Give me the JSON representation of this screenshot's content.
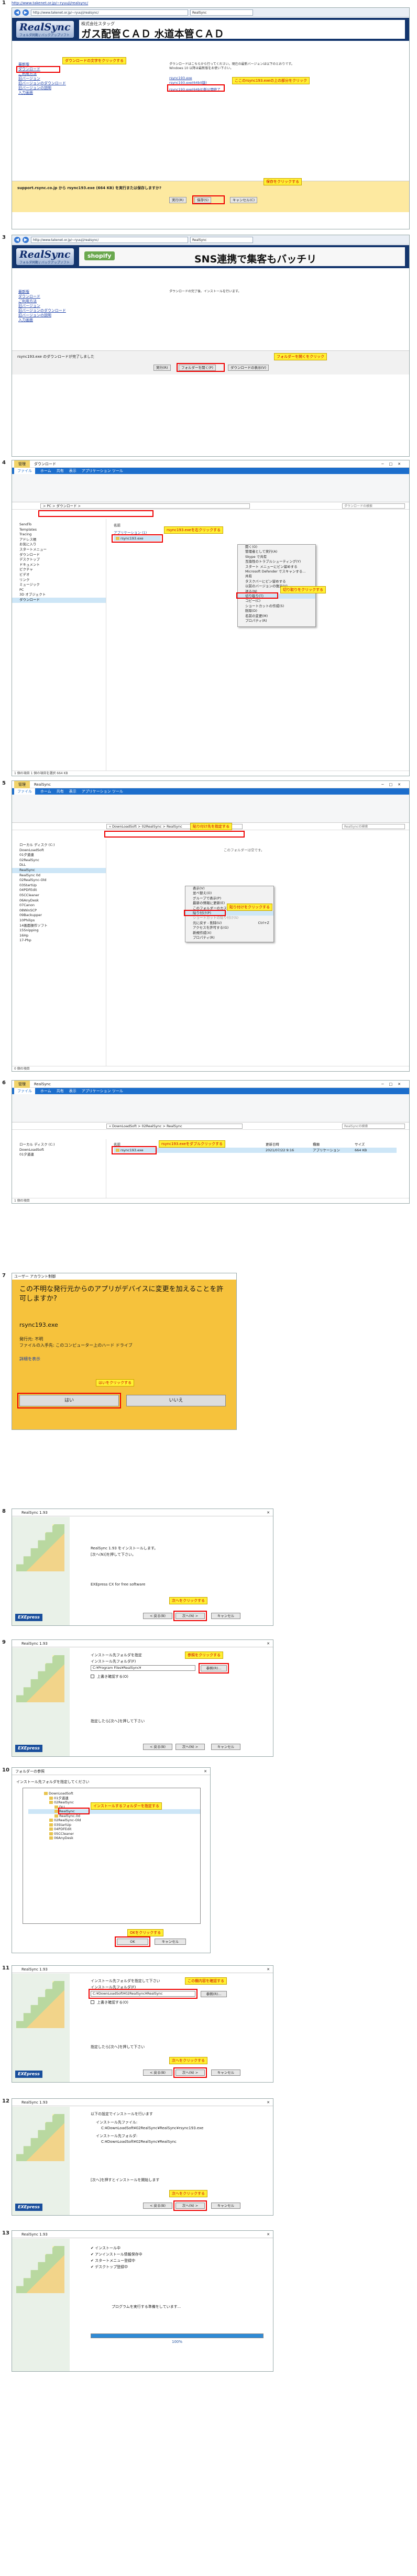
{
  "page_url": "http://www.takenet.or.jp/~ryuuji/realsync/",
  "steps": {
    "s1": {
      "num": "1",
      "ie_addr": "http://www.takenet.or.jp/~ryuuji/realsync/",
      "ie_tab": "RealSync",
      "logo": "RealSync",
      "logo_sub": "フォルダ同期 / バックアップソフト",
      "ad_small": "株式会社スタッグ",
      "ad_big": "ガス配管ＣＡＤ 水道本管ＣＡＤ",
      "nav": [
        "最新版",
        "ダウンロード",
        "ご利用方法",
        "旧バージョン",
        "旧バージョンのダウンロード",
        "旧バージョンの説明",
        "入力画面"
      ],
      "callout_dl": "ダウンロードの文字をクリックする",
      "body": "ダウンロードはこちらから行ってください。現在の最新バージョンは以下のとおりです。Windows 10 以降は最新版をお使い下さい。",
      "link1": "rsync193.exe",
      "link2": "rsync193.exe(64bit版)",
      "link3": "rsync193.exe(64bit)版公開終了",
      "callout_link": "ここのrsync193.exeの上の部分をクリック",
      "dl_text": "support.rsync.co.jp から rsync193.exe (664 KB) を実行または保存しますか?",
      "dl_run": "実行(R)",
      "dl_save": "保存(S)",
      "dl_cancel": "キャンセル(C)",
      "callout_save": "保存をクリックする"
    },
    "s3": {
      "num": "3",
      "ie_addr": "http://www.takenet.or.jp/~ryuuji/realsync/",
      "ie_tab": "RealSync",
      "logo": "RealSync",
      "logo_sub": "フォルダ同期 / バックアップソフト",
      "ad_small": "shopify",
      "ad_big": "SNS連携で集客もバッチリ",
      "nav": [
        "最新版",
        "ダウンロード",
        "ご利用方法",
        "旧バージョン",
        "旧バージョンのダウンロード",
        "旧バージョンの説明",
        "入力画面"
      ],
      "body": "ダウンロードの完了後、インストールを行います。",
      "dl_text": "rsync193.exe のダウンロードが完了しました",
      "dl_run": "実行(R)",
      "dl_folder": "フォルダーを開く(P)",
      "dl_view": "ダウンロードの表示(V)",
      "callout_folder": "フォルダーを開くをクリック"
    },
    "s4": {
      "num": "4",
      "title_tab": "管理",
      "title": "ダウンロード",
      "tabs": [
        "ファイル",
        "ホーム",
        "共有",
        "表示",
        "アプリケーション ツール"
      ],
      "addr": "> PC > ダウンロード >",
      "search": "ダウンロードの検索",
      "nav": [
        "SendTo",
        "Templates",
        "Tracing",
        "アドレス帳",
        "お気に入り",
        "スタートメニュー",
        "ダウンロード",
        "デスクトップ",
        "ドキュメント",
        "ピクチャ",
        "ビデオ",
        "リンク",
        "ミュージック",
        "PC",
        "3D オブジェクト",
        "ダウンロード"
      ],
      "col_name": "名前",
      "group": "アプリケーション (1)",
      "file": "rsync193.exe",
      "callout_file": "rsync193.exeを右クリックする",
      "ctx": [
        "開く(O)",
        "管理者として実行(A)",
        "Skype で共有",
        "互換性のトラブルシューティング(Y)",
        "スタート メニューにピン留めする",
        "Microsoft Defender でスキャンする...",
        "共有",
        "タスクバーにピン留めする",
        "以前のバージョンの復元(V)",
        "送る(N)",
        "切り取り(T)",
        "コピー(C)",
        "ショートカットの作成(S)",
        "削除(D)",
        "名前の変更(M)",
        "プロパティ(R)"
      ],
      "callout_cut": "切り取りをクリックする",
      "status": "1 個の項目  1 個の項目を選択  664 KB"
    },
    "s5": {
      "num": "5",
      "title_tab": "管理",
      "title": "RealSync",
      "tabs": [
        "ファイル",
        "ホーム",
        "共有",
        "表示",
        "アプリケーション ツール"
      ],
      "addr": "« DownLoadSoft > 02RealSync > RealSync",
      "search": "RealSyncの検索",
      "callout_addr": "貼り付け先を指定する",
      "nav": [
        "ローカル ディスク (C:)",
        "DownLoadSoft",
        "01夕道連",
        "02RealSync",
        "DLL",
        "RealSync",
        "RealSync 0d",
        "02RealSync-Old",
        "03StartUp",
        "04PDFEdit",
        "05CCleaner",
        "06AnyDesk",
        "07Canon",
        "08WinSCP",
        "09Backupper",
        "10Philips",
        "14画面操作ソフト",
        "15Snipping",
        "16Hp",
        "17-Php"
      ],
      "empty": "このフォルダーは空です。",
      "ctx": [
        "表示(V)",
        "並べ替え(O)",
        "グループで表示(P)",
        "最新の情報に更新(E)",
        "このフォルダーのカスタマイズ(F)...",
        "貼り付け(P)",
        "ショートカットの貼り付け(S)",
        "元に戻す - 削除(U)",
        "アクセスを許可する(G)",
        "新規作成(X)",
        "プロパティ(R)"
      ],
      "ctx_undo_key": "Ctrl+Z",
      "callout_paste": "貼り付けをクリックする",
      "status": "0 個の項目"
    },
    "s6": {
      "num": "6",
      "title_tab": "管理",
      "title": "RealSync",
      "tabs": [
        "ファイル",
        "ホーム",
        "共有",
        "表示",
        "アプリケーション ツール"
      ],
      "addr": "« DownLoadSoft > 02RealSync > RealSync",
      "search": "RealSyncの検索",
      "nav": [
        "ローカル ディスク (C:)",
        "DownLoadSoft",
        "01夕道連"
      ],
      "col_name": "名前",
      "col_date": "更新日時",
      "col_type": "種類",
      "col_size": "サイズ",
      "file": "rsync193.exe",
      "file_date": "2021/07/22 9:16",
      "file_type": "アプリケーション",
      "file_size": "664 KB",
      "callout_file": "rsync193.exeをダブルクリックする",
      "status": "1 個の項目"
    },
    "s7": {
      "num": "7",
      "head": "ユーザー アカウント制御",
      "question": "この不明な発行元からのアプリがデバイスに変更を加えることを許可しますか?",
      "app": "rsync193.exe",
      "publisher": "発行元: 不明",
      "origin": "ファイルの入手先: このコンピューター上のハード ドライブ",
      "details": "詳細を表示",
      "callout": "はいをクリックする",
      "yes": "はい",
      "no": "いいえ"
    },
    "s8": {
      "num": "8",
      "title": "RealSync 1.93",
      "line1": "RealSync 1.93 をインストールします。",
      "line2": "[次へ(N)]を押して下さい。",
      "exe": "EXEpress CX for free software",
      "callout": "次へをクリックする",
      "back": "< 戻る(B)",
      "next": "次へ(N) >",
      "cancel": "キャンセル",
      "badge": "EXEpress"
    },
    "s9": {
      "num": "9",
      "title": "RealSync 1.93",
      "line1": "インストール先フォルダを指定",
      "line2": "インストール先フォルダ(F)",
      "path": "C:¥Program Files¥RealSync¥",
      "browse": "参照(R)...",
      "callout": "参照をクリックする",
      "chk": "上書き確認する(O)",
      "footer": "指定したら[次へ]を押して下さい",
      "back": "< 戻る(B)",
      "next": "次へ(N) >",
      "cancel": "キャンセル",
      "badge": "EXEpress"
    },
    "s10": {
      "num": "10",
      "title": "フォルダーの参照",
      "prompt": "インストール先フォルダを指定してください",
      "tree": [
        "DownLoadSoft",
        "01夕道連",
        "02RealSync",
        "DLL",
        "RealSync",
        "RealSync.0d",
        "02RealSync-Old",
        "03StartUp",
        "04PDFEdit",
        "05CCleaner",
        "06AnyDesk"
      ],
      "callout_tree": "インストールするフォルダーを指定する",
      "callout_ok": "OKをクリックする",
      "ok": "OK",
      "cancel": "キャンセル"
    },
    "s11": {
      "num": "11",
      "title": "RealSync 1.93",
      "line1": "インストール先フォルダを指定して下さい",
      "line2": "インストール先フォルダ(F)",
      "path": "C:¥DownLoadSoft¥02RealSync¥RealSync",
      "browse": "参照(R)...",
      "callout_path": "この欄内容を確認する",
      "chk": "上書き確認する(O)",
      "footer": "指定したら[次へ]を押して下さい",
      "callout": "次へをクリックする",
      "back": "< 戻る(B)",
      "next": "次へ(N) >",
      "cancel": "キャンセル",
      "badge": "EXEpress"
    },
    "s12": {
      "num": "12",
      "title": "RealSync 1.93",
      "line1": "以下の設定でインストールを行います",
      "line2": "インストール先ファイル:",
      "line3": "C:¥DownLoadSoft¥02RealSync¥RealSync¥rsync193.exe",
      "line4": "インストール先フォルダ:",
      "line5": "C:¥DownLoadSoft¥02RealSync¥RealSync",
      "footer": "[次へ]を押すとインストールを開始します",
      "callout": "次へをクリックする",
      "back": "< 戻る(B)",
      "next": "次へ(N) >",
      "cancel": "キャンセル",
      "badge": "EXEpress"
    },
    "s13": {
      "num": "13",
      "title": "RealSync 1.93",
      "checks": [
        "インストール中",
        "アンインストール情報保存中",
        "スタートメニュー登録中",
        "デスクトップ登録中"
      ],
      "wait": "プログラムを実行する準備をしています...",
      "progress_pct": 100,
      "progress_label": "100%"
    }
  }
}
